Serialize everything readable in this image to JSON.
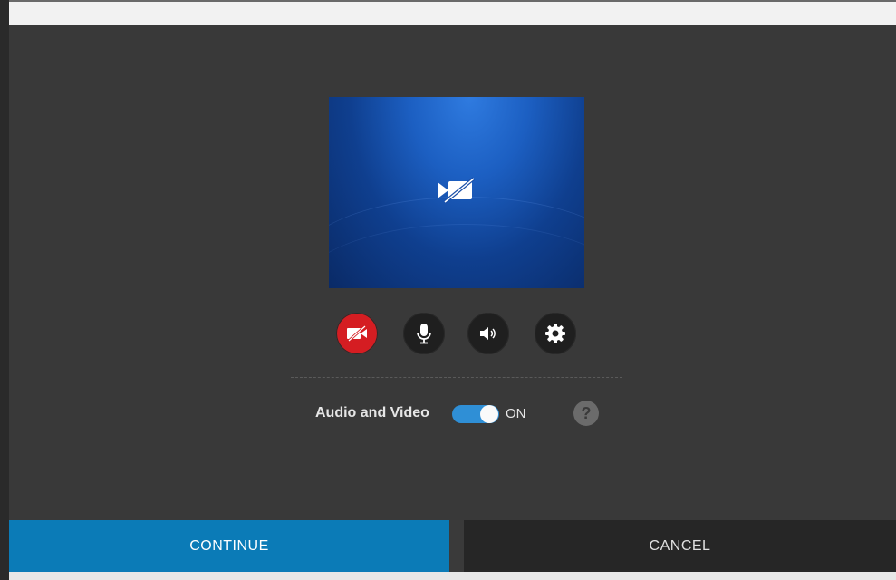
{
  "preview": {
    "icon": "video-off-icon"
  },
  "controls": [
    {
      "name": "camera-toggle-button",
      "icon": "video-off-icon",
      "color": "#d51d22"
    },
    {
      "name": "microphone-button",
      "icon": "microphone-icon",
      "color": "#1f1f1f"
    },
    {
      "name": "speaker-button",
      "icon": "speaker-icon",
      "color": "#1f1f1f"
    },
    {
      "name": "settings-button",
      "icon": "gear-icon",
      "color": "#1f1f1f"
    }
  ],
  "audio_video": {
    "label": "Audio and Video",
    "state": "ON",
    "enabled": true,
    "help": "?"
  },
  "buttons": {
    "continue_label": "CONTINUE",
    "cancel_label": "CANCEL"
  },
  "colors": {
    "accent": "#0b7bb7",
    "toggle": "#2f8fd6",
    "camera_off": "#d51d22",
    "background": "#393939"
  }
}
